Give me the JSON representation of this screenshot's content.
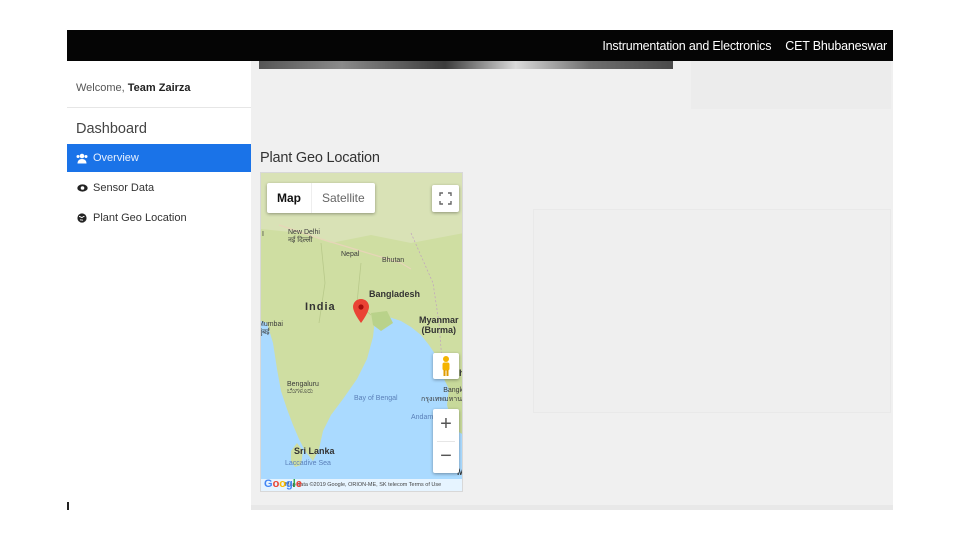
{
  "header": {
    "links": [
      "Instrumentation and Electronics",
      "CET Bhubaneswar"
    ]
  },
  "sidebar": {
    "welcome_prefix": "Welcome,",
    "welcome_user": "Team Zairza",
    "section_title": "Dashboard",
    "items": [
      {
        "label": "Overview",
        "icon": "users-icon",
        "active": true
      },
      {
        "label": "Sensor Data",
        "icon": "eye-icon",
        "active": false
      },
      {
        "label": "Plant Geo Location",
        "icon": "globe-icon",
        "active": false
      }
    ]
  },
  "main": {
    "panel_title": "Plant Geo Location"
  },
  "map": {
    "type_options": [
      "Map",
      "Satellite"
    ],
    "selected_type": "Map",
    "labels": {
      "new_delhi": "New Delhi\nनई दिल्ली",
      "nepal": "Nepal",
      "bhutan": "Bhutan",
      "bangladesh": "Bangladesh",
      "india": "India",
      "myanmar": "Myanmar\n(Burma)",
      "mumbai": "Mumbai\nमुंबई",
      "bengaluru": "Bengaluru\nಬೆಂಗಳೂರು",
      "bay_of_bengal": "Bay of Bengal",
      "bangkok": "Bangkok\nกรุงเทพมหานคร",
      "andaman": "Andam",
      "sri_lanka": "Sri Lanka",
      "laccadive": "Laccadive Sea",
      "edge_h": "h",
      "edge_m": "M",
      "edge_i": "I"
    },
    "zoom_in": "+",
    "zoom_out": "−",
    "logo_text": "Google",
    "credits": "Map data ©2019 Google, ORION-ME, SK telecom   Terms of Use",
    "colors": {
      "land": "#cbdc9e",
      "water": "#aadaff",
      "marker": "#ea4335",
      "active_nav": "#1a73e8"
    }
  }
}
